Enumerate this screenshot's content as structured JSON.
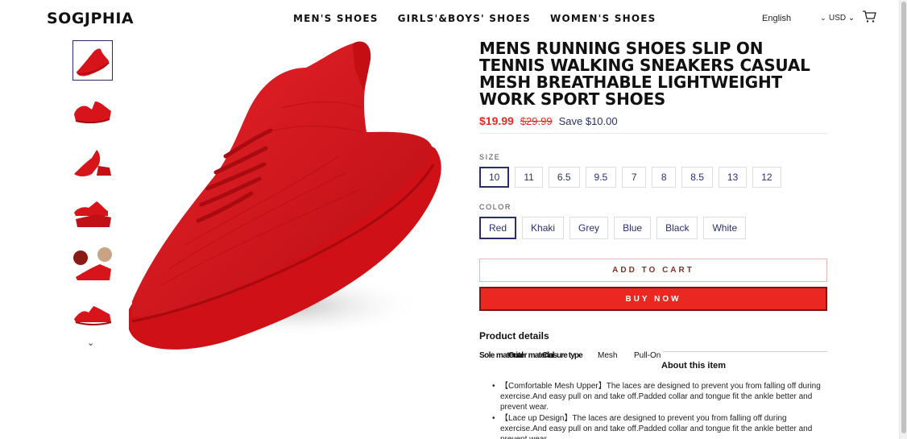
{
  "header": {
    "logo": "SOGJPHIA",
    "nav": [
      "MEN'S SHOES",
      "GIRLS'&BOYS' SHOES",
      "WOMEN'S SHOES"
    ],
    "language": "English",
    "currency": "USD",
    "chevron": "⌄"
  },
  "gallery": {
    "down_arrow": "⌄",
    "thumbnail_count": 6
  },
  "product": {
    "title": "MENS RUNNING SHOES SLIP ON TENNIS WALKING SNEAKERS CASUAL MESH BREATHABLE LIGHTWEIGHT WORK SPORT SHOES",
    "price": "$19.99",
    "compare_price": "$29.99",
    "save": "Save $10.00",
    "size_label": "SIZE",
    "sizes": [
      "10",
      "11",
      "6.5",
      "9.5",
      "7",
      "8",
      "8.5",
      "13",
      "12"
    ],
    "selected_size": "10",
    "color_label": "COLOR",
    "colors": [
      "Red",
      "Khaki",
      "Grey",
      "Blue",
      "Black",
      "White"
    ],
    "selected_color": "Red",
    "add_to_cart": "ADD TO CART",
    "buy_now": "BUY NOW"
  },
  "details": {
    "heading": "Product details",
    "key1": "Sole material",
    "key2": "Outer material",
    "key3": "Closure type",
    "value1": "Mesh",
    "value2": "Pull-On",
    "about_heading": "About this item",
    "bullets": [
      "【Comfortable Mesh Upper】The laces are designed to prevent you from falling off during exercise.And easy pull on and take off.Padded collar and tongue fit the ankle better and prevent wear.",
      "【Lace up Design】The laces are designed to prevent you from falling off during exercise.And easy pull on and take off.Padded collar and tongue fit the ankle better and prevent wear."
    ]
  },
  "colors": {
    "accent": "#2a2f6b",
    "sale": "#e62a24",
    "buy_button": "#ea2720",
    "shoe": "#d8141b"
  }
}
